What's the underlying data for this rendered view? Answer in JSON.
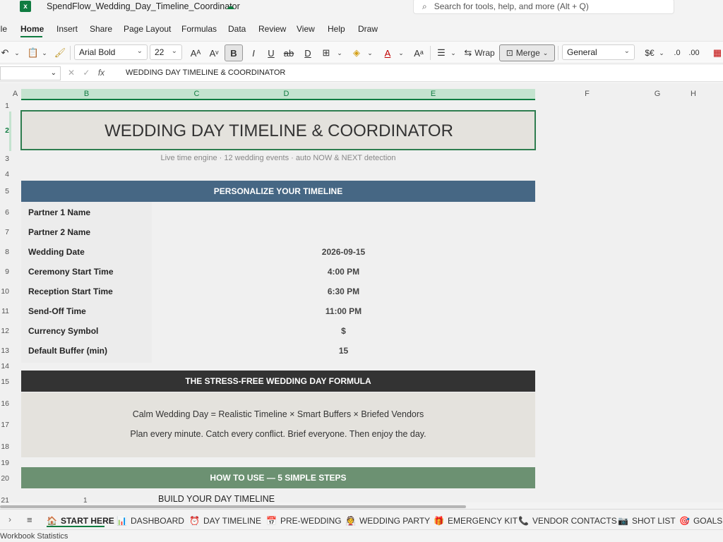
{
  "window": {
    "title": "SpendFlow_Wedding_Day_Timeline_Coordinator",
    "search_placeholder": "Search for tools, help, and more (Alt + Q)"
  },
  "menu": [
    "ile",
    "Home",
    "Insert",
    "Share",
    "Page Layout",
    "Formulas",
    "Data",
    "Review",
    "View",
    "Help",
    "Draw"
  ],
  "ribbon": {
    "font_name": "Arial Bold",
    "font_size": "22",
    "wrap_label": "Wrap",
    "merge_label": "Merge",
    "number_format": "General"
  },
  "formula_bar": {
    "content": "WEDDING DAY TIMELINE & COORDINATOR"
  },
  "columns": [
    "A",
    "B",
    "C",
    "D",
    "E",
    "F",
    "G",
    "H"
  ],
  "rows": [
    "1",
    "2",
    "3",
    "4",
    "5",
    "6",
    "7",
    "8",
    "9",
    "10",
    "11",
    "12",
    "13",
    "14",
    "15",
    "16",
    "17",
    "18",
    "19",
    "20",
    "21"
  ],
  "sheet": {
    "title": "WEDDING DAY TIMELINE & COORDINATOR",
    "subtitle": "Live time engine · 12 wedding events · auto NOW & NEXT detection",
    "personalize_header": "PERSONALIZE YOUR TIMELINE",
    "fields": [
      {
        "label": "Partner 1 Name",
        "value": ""
      },
      {
        "label": "Partner 2 Name",
        "value": ""
      },
      {
        "label": "Wedding Date",
        "value": "2026-09-15"
      },
      {
        "label": "Ceremony Start Time",
        "value": "4:00 PM"
      },
      {
        "label": "Reception Start Time",
        "value": "6:30 PM"
      },
      {
        "label": "Send-Off Time",
        "value": "11:00 PM"
      },
      {
        "label": "Currency Symbol",
        "value": "$"
      },
      {
        "label": "Default Buffer (min)",
        "value": "15"
      }
    ],
    "formula_header": "THE STRESS-FREE WEDDING DAY FORMULA",
    "formula_line1": "Calm Wedding Day  =  Realistic Timeline  ×  Smart Buffers  ×  Briefed Vendors",
    "formula_line2": "Plan every minute. Catch every conflict. Brief everyone. Then enjoy the day.",
    "howto_header": "HOW TO USE — 5 SIMPLE STEPS",
    "step1": "BUILD YOUR DAY TIMELINE",
    "step1_mark": "1"
  },
  "sheet_tabs": [
    {
      "label": "START HERE",
      "icon": "🏠"
    },
    {
      "label": "DASHBOARD",
      "icon": "📊"
    },
    {
      "label": "DAY TIMELINE",
      "icon": "⏰"
    },
    {
      "label": "PRE-WEDDING",
      "icon": "📅"
    },
    {
      "label": "WEDDING PARTY",
      "icon": "👰"
    },
    {
      "label": "EMERGENCY KIT",
      "icon": "🎁"
    },
    {
      "label": "VENDOR CONTACTS",
      "icon": "📞"
    },
    {
      "label": "SHOT LIST",
      "icon": "📷"
    },
    {
      "label": "GOALS",
      "icon": "🎯"
    }
  ],
  "status": {
    "text": "Workbook Statistics"
  },
  "colors": {
    "accent": "#107c41",
    "band_blue": "#466784",
    "band_dark": "#333333",
    "band_green": "#6c9172",
    "panel": "#e4e2dd"
  }
}
